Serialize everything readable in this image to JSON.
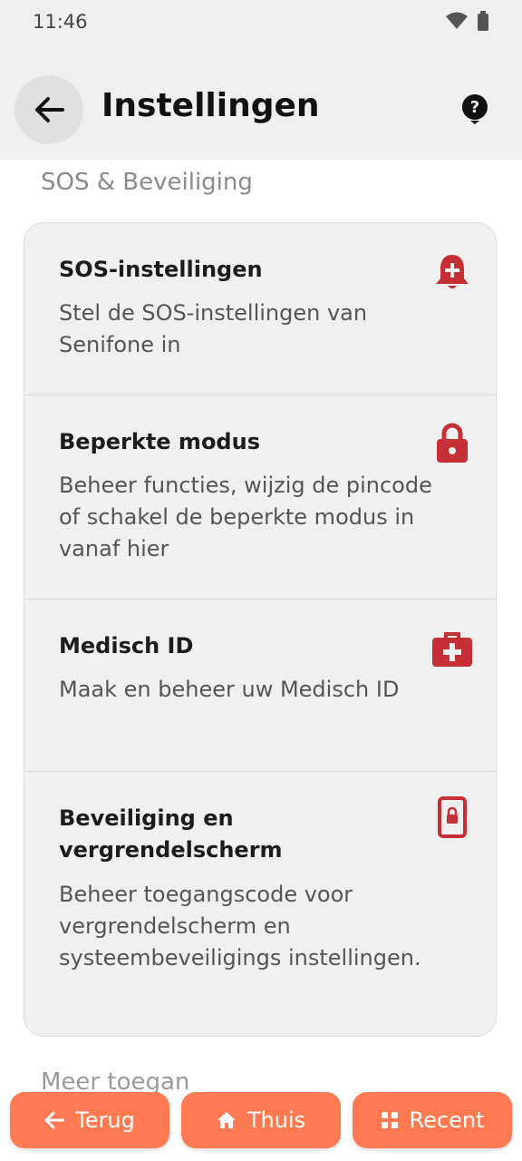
{
  "status": {
    "time": "11:46"
  },
  "header": {
    "title": "Instellingen"
  },
  "section": {
    "title": "SOS & Beveiliging"
  },
  "items": [
    {
      "title": "SOS-instellingen",
      "description": "Stel de SOS-instellingen van Senifone in",
      "icon": "bell-plus-icon"
    },
    {
      "title": "Beperkte modus",
      "description": "Beheer functies, wijzig de pincode of schakel de beperkte modus in vanaf hier",
      "icon": "lock-icon"
    },
    {
      "title": "Medisch ID",
      "description": "Maak en beheer uw Medisch ID",
      "icon": "medical-kit-icon"
    },
    {
      "title": "Beveiliging en vergrendelscherm",
      "description": "Beheer toegangscode voor vergrendelscherm en systeembeveiligings instellingen.",
      "icon": "phone-lock-icon"
    }
  ],
  "next_section_partial": "Meer toegan",
  "nav": {
    "back": "Terug",
    "home": "Thuis",
    "recent": "Recent"
  },
  "colors": {
    "accent": "#ff7a50",
    "icon_red": "#c62f36"
  }
}
